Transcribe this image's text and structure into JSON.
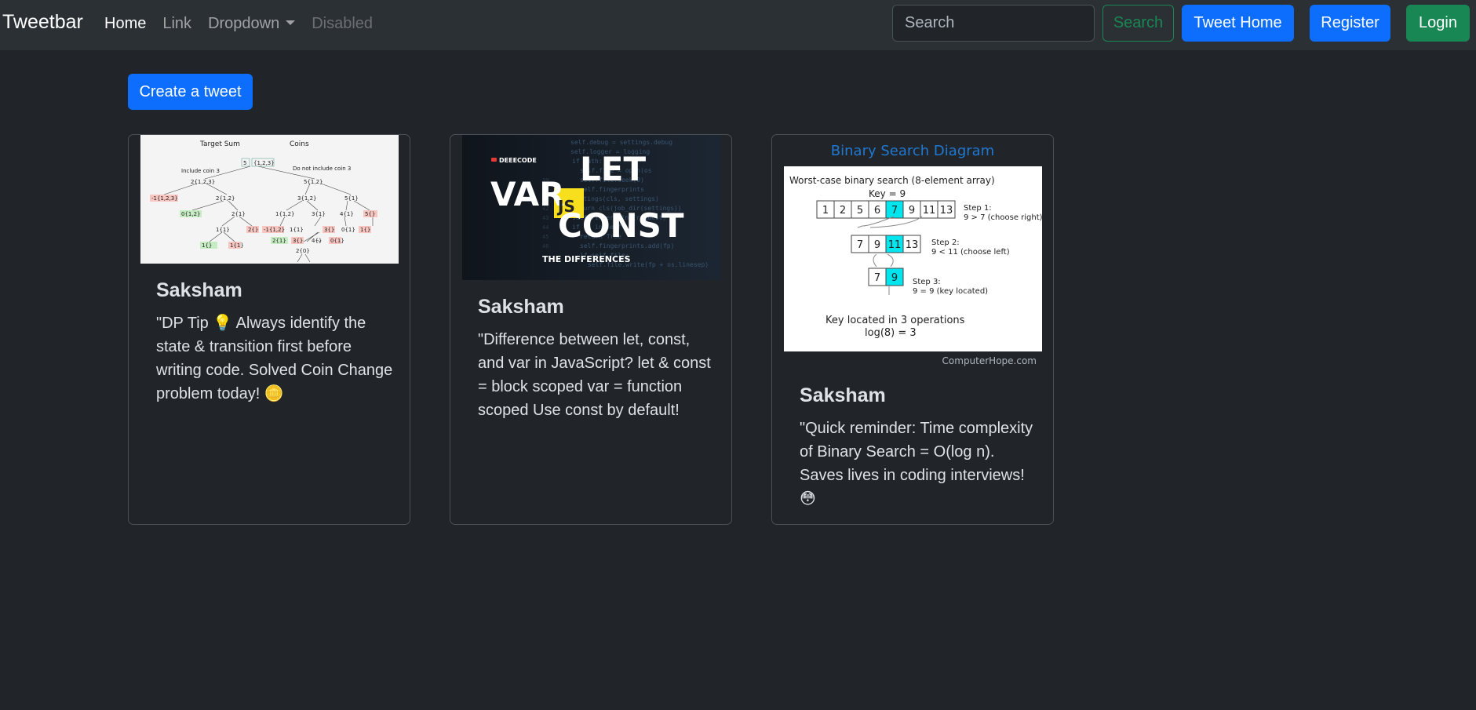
{
  "navbar": {
    "brand": "Tweetbar",
    "links": [
      "Home",
      "Link",
      "Dropdown",
      "Disabled"
    ],
    "search_placeholder": "Search",
    "search_button": "Search",
    "tweet_home": "Tweet Home",
    "register": "Register",
    "login": "Login"
  },
  "create_tweet": "Create a tweet",
  "tweets": [
    {
      "author": "Saksham",
      "text": "\"DP Tip 💡 Always identify the state & transition first before writing code. Solved Coin Change problem today! 🪙",
      "image": {
        "kind": "coin-change-tree",
        "labels": [
          "Target Sum",
          "Coins",
          "Include coin 3",
          "Do not include coin 3",
          "5",
          "{1,2,3}",
          "2{1,2,3}",
          "5{1,2}",
          "-1{1,2,3}",
          "2{1,2}",
          "3{1,2}",
          "5{1}",
          "0{1,2}",
          "2{1}",
          "1{1,2}",
          "3{1}",
          "4{1}",
          "5{}",
          "1{1}",
          "2{}",
          "-1{1,2}",
          "1{1}",
          "3{}",
          "0{1}",
          "1{}",
          "2{1}",
          "3{}",
          "4{}",
          "0{1}",
          "1{}",
          "1{1}",
          "2{0}"
        ]
      }
    },
    {
      "author": "Saksham",
      "text": "\"Difference between let, const, and var in JavaScript? let & const = block scoped var = function scoped Use const by default!",
      "image": {
        "kind": "js-var-let-const",
        "channel": "DEEECODE",
        "words": [
          "LET",
          "VAR",
          "JS",
          "CONST"
        ],
        "subtitle": "THE DIFFERENCES"
      }
    },
    {
      "author": "Saksham",
      "text": "\"Quick reminder: Time complexity of Binary Search = O(log n). Saves lives in coding interviews! 😳",
      "image": {
        "kind": "binary-search-diagram",
        "title": "Binary Search Diagram",
        "heading": "Worst-case binary search (8-element array)",
        "key": "Key = 9",
        "row1": [
          "1",
          "2",
          "5",
          "6",
          "7",
          "9",
          "11",
          "13"
        ],
        "row2": [
          "7",
          "9",
          "11",
          "13"
        ],
        "row3": [
          "7",
          "9"
        ],
        "step1": [
          "Step 1:",
          "9 > 7 (choose right)"
        ],
        "step2": [
          "Step 2:",
          "9 < 11 (choose left)"
        ],
        "step3": [
          "Step 3:",
          "9 = 9 (key located)"
        ],
        "result": [
          "Key located in 3 operations",
          "log(8) = 3"
        ],
        "credit": "ComputerHope.com"
      }
    }
  ]
}
